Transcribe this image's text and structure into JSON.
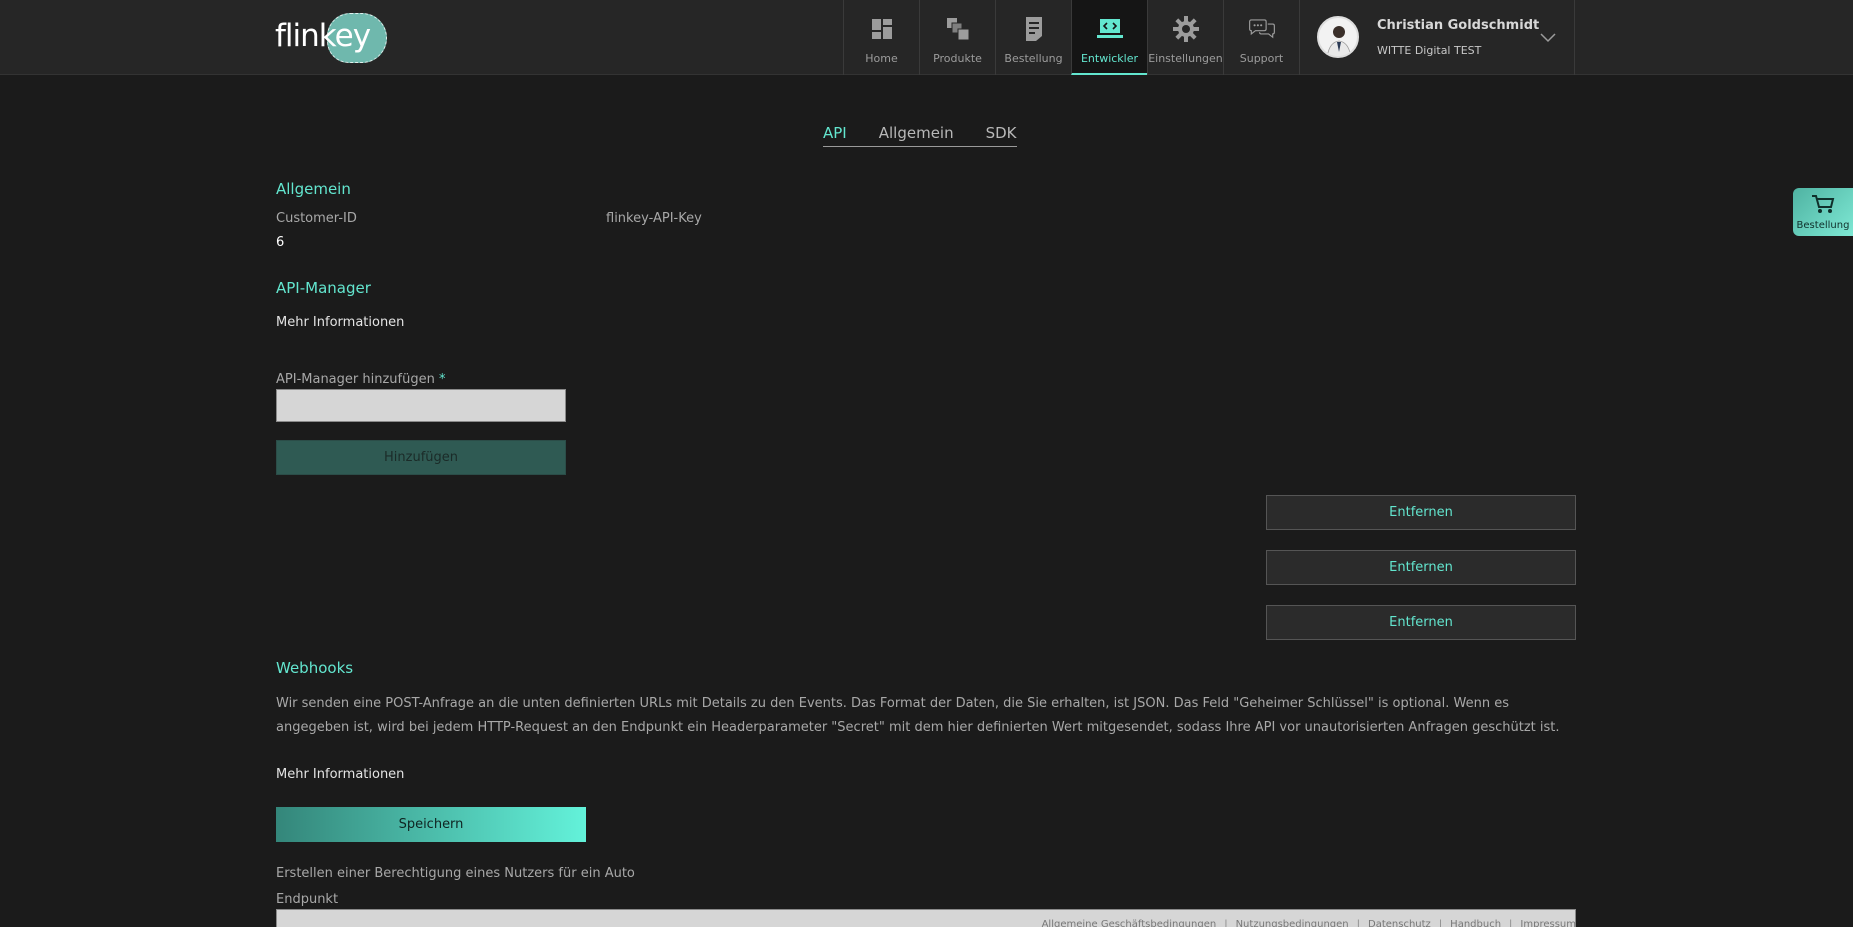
{
  "logo": {
    "text": "flinkey"
  },
  "nav": {
    "items": [
      {
        "label": "Home",
        "icon": "dashboard-icon"
      },
      {
        "label": "Produkte",
        "icon": "products-icon"
      },
      {
        "label": "Bestellung",
        "icon": "order-document-icon"
      },
      {
        "label": "Entwickler",
        "icon": "developer-laptop-icon",
        "active": true
      },
      {
        "label": "Einstellungen",
        "icon": "gear-icon"
      },
      {
        "label": "Support",
        "icon": "chat-bubbles-icon"
      }
    ]
  },
  "profile": {
    "name": "Christian Goldschmidt",
    "org": "WITTE Digital TEST"
  },
  "tabs": [
    {
      "label": "API",
      "active": true
    },
    {
      "label": "Allgemein"
    },
    {
      "label": "SDK"
    }
  ],
  "allgemein": {
    "heading": "Allgemein",
    "customer_id_label": "Customer-ID",
    "customer_id_value": "6",
    "api_key_label": "flinkey-API-Key"
  },
  "api_manager": {
    "heading": "API-Manager",
    "more_info": "Mehr Informationen",
    "add_label": "API-Manager hinzufügen",
    "required_mark": "*",
    "add_input_value": "",
    "add_button": "Hinzufügen",
    "remove_buttons": [
      "Entfernen",
      "Entfernen",
      "Entfernen"
    ]
  },
  "webhooks": {
    "heading": "Webhooks",
    "description": "Wir senden eine POST-Anfrage an die unten definierten URLs mit Details zu den Events. Das Format der Daten, die Sie erhalten, ist JSON. Das Feld \"Geheimer Schlüssel\" is optional. Wenn es angegeben ist, wird bei jedem HTTP-Request an den Endpunkt ein Headerparameter \"Secret\" mit dem hier definierten Wert mitgesendet, sodass Ihre API vor unautorisierten Anfragen geschützt ist.",
    "more_info": "Mehr Informationen",
    "save_button": "Speichern",
    "event_text": "Erstellen einer Berechtigung eines Nutzers für ein Auto",
    "endpoint_label": "Endpunkt",
    "endpoint_value": ""
  },
  "footer": {
    "links": [
      "Allgemeine Geschäftsbedingungen",
      "Nutzungsbedingungen",
      "Datenschutz",
      "Handbuch",
      "Impressum"
    ]
  },
  "cart": {
    "label": "Bestellung",
    "icon": "cart-icon"
  },
  "colors": {
    "accent": "#63e6cf",
    "background": "#1b1b1b",
    "topbar": "#262626"
  }
}
